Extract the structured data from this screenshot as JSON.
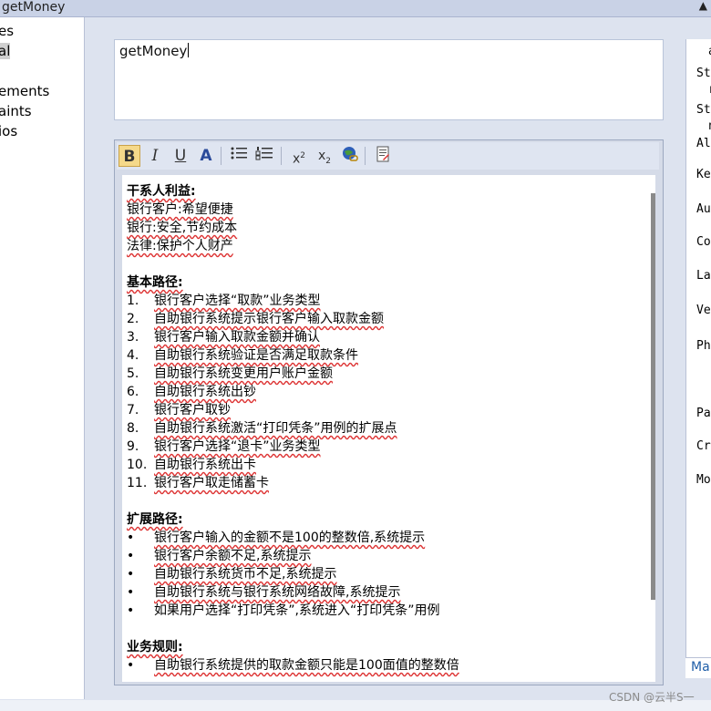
{
  "window": {
    "title": "getMoney",
    "scroll_glyph": "▲"
  },
  "left_tree": {
    "items": [
      {
        "label": "es"
      },
      {
        "label": "al"
      },
      {
        "label": "ements"
      },
      {
        "label": "aints"
      },
      {
        "label": "ios"
      }
    ]
  },
  "name_field": {
    "value": "getMoney"
  },
  "toolbar": {
    "bold": "B",
    "italic": "I",
    "underline": "U",
    "font": "A",
    "superscript": "x",
    "sup_mark": "2",
    "subscript": "x",
    "sub_mark": "2"
  },
  "content": {
    "stakeholders_heading": "干系人利益:",
    "stakeholders": [
      "银行客户:希望便捷",
      "银行:安全,节约成本",
      "法律:保护个人财产"
    ],
    "basic_path_heading": "基本路径:",
    "basic_path": [
      {
        "num": "1.",
        "text": "银行客户选择“取款”业务类型"
      },
      {
        "num": "2.",
        "text": "自助银行系统提示银行客户输入取款金额"
      },
      {
        "num": "3.",
        "text": "银行客户输入取款金额并确认"
      },
      {
        "num": "4.",
        "text": "自助银行系统验证是否满足取款条件"
      },
      {
        "num": "5.",
        "text": "自助银行系统变更用户账户金额"
      },
      {
        "num": "6.",
        "text": "自助银行系统出钞"
      },
      {
        "num": "7.",
        "text": "银行客户取钞"
      },
      {
        "num": "8.",
        "text": "自助银行系统激活“打印凭条”用例的扩展点"
      },
      {
        "num": "9.",
        "text": "银行客户选择“退卡”业务类型"
      },
      {
        "num": "10.",
        "text": "自助银行系统出卡"
      },
      {
        "num": "11.",
        "text": "银行客户取走储蓄卡"
      }
    ],
    "extension_heading": "扩展路径:",
    "extensions": [
      "银行客户输入的金额不是100的整数倍,系统提示",
      "银行客户余额不足,系统提示",
      "自助银行系统货币不足,系统提示",
      "自助银行系统与银行系统网络故障,系统提示",
      "如果用户选择“打印凭条”,系统进入“打印凭条”用例"
    ],
    "rules_heading": "业务规则:",
    "rules": [
      "自助银行系统提供的取款金额只能是100面值的整数倍"
    ],
    "bullet": "•"
  },
  "right_panel": {
    "props": [
      "a",
      "St",
      "r",
      "St",
      "n",
      "Al",
      "Ke",
      "Au",
      "Co",
      "La",
      "Ve",
      "Ph",
      "Pa",
      "Cr",
      "Mo"
    ],
    "tab_label": "Ma"
  },
  "watermark": "CSDN @云半S一"
}
